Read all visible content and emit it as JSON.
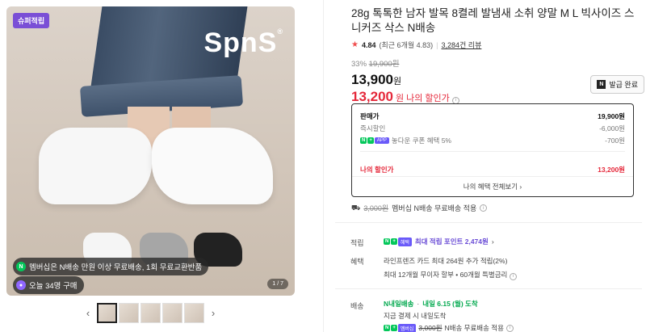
{
  "gallery": {
    "badge": "슈퍼적립",
    "brand": "SpnS",
    "pill_membership": "멤버십은 N배송 만원 이상 무료배송, 1회 무료교환반품",
    "pill_today": "오늘 34명 구매",
    "page_indicator": "1 / 7",
    "prev_icon": "chevron-left-icon",
    "next_icon": "chevron-right-icon"
  },
  "product": {
    "title": "28g 톡톡한 남자 발목 8켤레 발냄새 소취 양말 M L 빅사이즈 스니커즈 삭스 N배송",
    "rating": "4.84",
    "rating_recent": "(최근 6개월 4.83)",
    "review_count": "3,284건 리뷰",
    "discount_rate": "33%",
    "original_price": "19,900원",
    "price": "13,900",
    "won": "원",
    "my_price": "13,200",
    "my_price_label": "나의 할인가",
    "coupon_label": "발급 완료"
  },
  "price_box": {
    "head_label": "판매가",
    "head_value": "19,900원",
    "instant_label": "즉시할인",
    "instant_value": "-6,000원",
    "app_tag": "APP",
    "app_label": "놓다운 쿠폰 혜택 5%",
    "app_value": "-700원",
    "mine_label": "나의 할인가",
    "mine_value": "13,200원",
    "more_label": "나의 혜택 전체보기"
  },
  "shipping_note": {
    "strike": "3,000원",
    "text": "멤버십 N배송 무료배송 적용"
  },
  "points": {
    "label": "적립",
    "tag": "N+",
    "text": "최대 적립 포인트 2,474원"
  },
  "benefit": {
    "label": "혜택",
    "line1": "라인프렌즈 카드 최대 264원 추가 적립(2%)",
    "line2": "최대 12개월 무이자 할부 • 60개월 특별금리"
  },
  "delivery": {
    "label": "배송",
    "brand": "N내일배송",
    "date": "내일 6.15 (월) 도착",
    "sub": "지금 결제 시 내일도착",
    "tag": "멤버십",
    "strike": "3,000원",
    "free": "N배송 무료배송 적용"
  },
  "colors": {
    "red": "#e5283a",
    "green": "#03c75a",
    "purple": "#7a4fd6"
  }
}
